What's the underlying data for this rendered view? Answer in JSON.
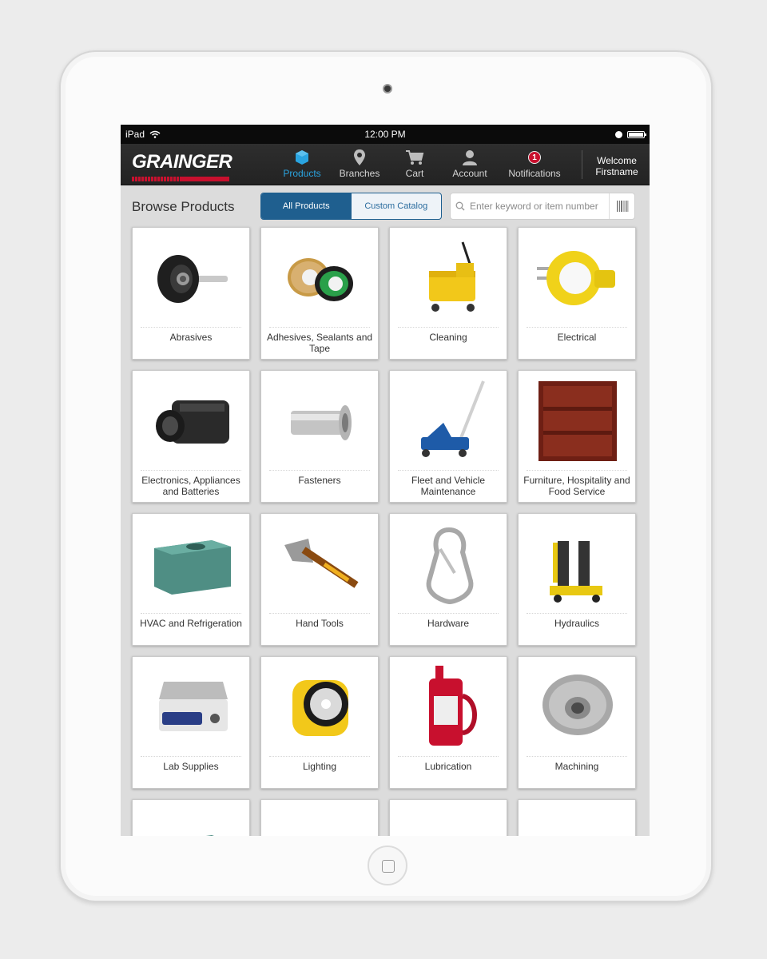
{
  "status_bar": {
    "device": "iPad",
    "time": "12:00 PM"
  },
  "brand": {
    "logo_text": "GRAINGER",
    "accent_color": "#c8102e",
    "active_color": "#2aa4e0"
  },
  "nav": {
    "items": [
      {
        "label": "Products",
        "icon": "cube-icon",
        "active": true
      },
      {
        "label": "Branches",
        "icon": "map-pin-icon"
      },
      {
        "label": "Cart",
        "icon": "cart-icon"
      },
      {
        "label": "Account",
        "icon": "user-icon"
      },
      {
        "label": "Notifications",
        "icon": "notification-badge",
        "badge": "1"
      }
    ],
    "welcome_line1": "Welcome",
    "welcome_line2": "Firstname"
  },
  "toolbar": {
    "title": "Browse Products",
    "segments": [
      {
        "label": "All Products",
        "active": true
      },
      {
        "label": "Custom Catalog"
      }
    ],
    "search_placeholder": "Enter keyword or item number"
  },
  "categories": [
    {
      "label": "Abrasives",
      "icon": "abrasive-disc-image"
    },
    {
      "label": "Adhesives, Sealants and Tape",
      "icon": "tape-rolls-image"
    },
    {
      "label": "Cleaning",
      "icon": "mop-bucket-image"
    },
    {
      "label": "Electrical",
      "icon": "plug-image"
    },
    {
      "label": "Electronics, Appliances and Batteries",
      "icon": "camcorder-image"
    },
    {
      "label": "Fasteners",
      "icon": "anchor-fastener-image"
    },
    {
      "label": "Fleet and Vehicle Maintenance",
      "icon": "floor-jack-image"
    },
    {
      "label": "Furniture, Hospitality and Food Service",
      "icon": "bookshelf-image"
    },
    {
      "label": "HVAC and Refrigeration",
      "icon": "hvac-unit-image"
    },
    {
      "label": "Hand Tools",
      "icon": "axe-image"
    },
    {
      "label": "Hardware",
      "icon": "carabiner-image"
    },
    {
      "label": "Hydraulics",
      "icon": "hydraulic-cart-image"
    },
    {
      "label": "Lab Supplies",
      "icon": "hot-plate-image"
    },
    {
      "label": "Lighting",
      "icon": "lantern-image"
    },
    {
      "label": "Lubrication",
      "icon": "oil-can-image"
    },
    {
      "label": "Machining",
      "icon": "grinding-wheel-image"
    },
    {
      "label": "",
      "icon": "hvac-unit-image"
    },
    {
      "label": "",
      "icon": "axe-image"
    },
    {
      "label": "",
      "icon": "eyebolt-image"
    },
    {
      "label": "",
      "icon": "hydraulic-cart-image"
    }
  ]
}
